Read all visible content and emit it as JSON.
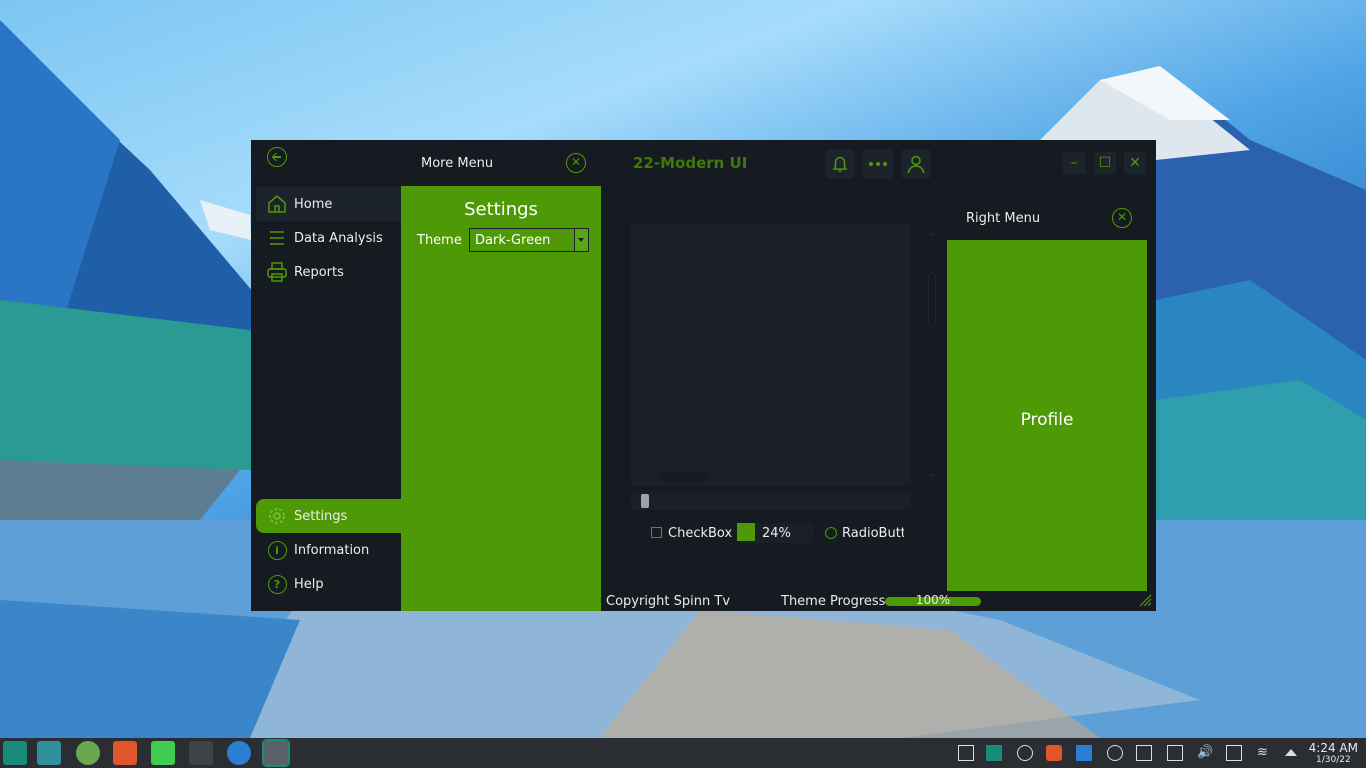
{
  "window": {
    "title": "22-Modern UI",
    "minimize_label": "–",
    "maximize_label": "☐",
    "close_label": "✕"
  },
  "left_menu": {
    "items": [
      {
        "label": "Home",
        "icon": "home-icon"
      },
      {
        "label": "Data Analysis",
        "icon": "list-icon"
      },
      {
        "label": "Reports",
        "icon": "printer-icon"
      },
      {
        "label": "Settings",
        "icon": "gear-icon"
      },
      {
        "label": "Information",
        "icon": "info-icon"
      },
      {
        "label": "Help",
        "icon": "help-icon"
      }
    ],
    "info_glyph": "i",
    "help_glyph": "?"
  },
  "more_menu": {
    "title": "More Menu",
    "close_glyph": "✕",
    "settings_title": "Settings",
    "theme_label": "Theme",
    "theme_value": "Dark-Green"
  },
  "content": {
    "checkbox_label": "CheckBox",
    "progress_text": "24%",
    "progress_value": 24,
    "radio_label": "RadioButton"
  },
  "status": {
    "copyright": "Copyright Spinn Tv",
    "theme_progress_label": "Theme Progress",
    "theme_progress_text": "100%",
    "theme_progress_value": 100
  },
  "right_menu": {
    "title": "Right Menu",
    "close_glyph": "✕",
    "profile": "Profile"
  },
  "taskbar": {
    "time": "4:24 AM",
    "date": "1/30/22"
  },
  "colors": {
    "accent": "#4e9a06",
    "background": "#161b22",
    "panel": "#1d232b"
  }
}
